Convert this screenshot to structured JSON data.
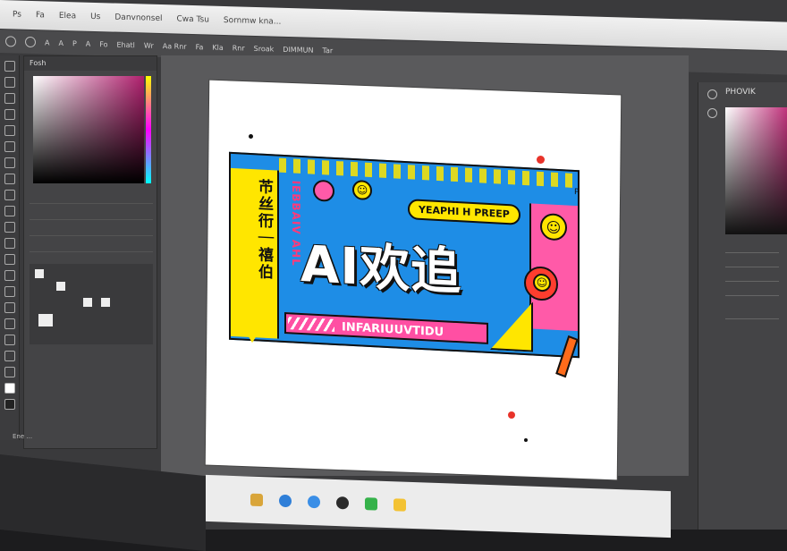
{
  "menubar": {
    "items": [
      "Ps",
      "Fa",
      "Elea",
      "Us",
      "Danvnonsel",
      "Cwa Tsu",
      "Sornmw kna..."
    ]
  },
  "optionsbar": {
    "items": [
      "A",
      "A",
      "P",
      "A",
      "Fo",
      "Ehatl",
      "Wr",
      "Aa Rnr",
      "Fa",
      "Kla",
      "Rnr",
      "Sroak",
      "DIMMUN",
      "Tar"
    ]
  },
  "left_panel": {
    "title": "Fosh"
  },
  "right_panel": {
    "title": "PHOVIK"
  },
  "banner": {
    "side_text": "芇丝衎｜禧伯",
    "pink_side_text": "IEBBAIV AHL",
    "pill_text": "YEAPHI H PREEP",
    "headline": "AI欢追",
    "subbar_text": "INFARIUUVTIDU",
    "corner_mark": "P"
  },
  "statusbar": {
    "text": "Ene  ..."
  },
  "colors": {
    "accent_blue": "#1e8de6",
    "accent_yellow": "#ffe600",
    "accent_pink": "#ff5aa8",
    "accent_red": "#ff3d2e"
  }
}
